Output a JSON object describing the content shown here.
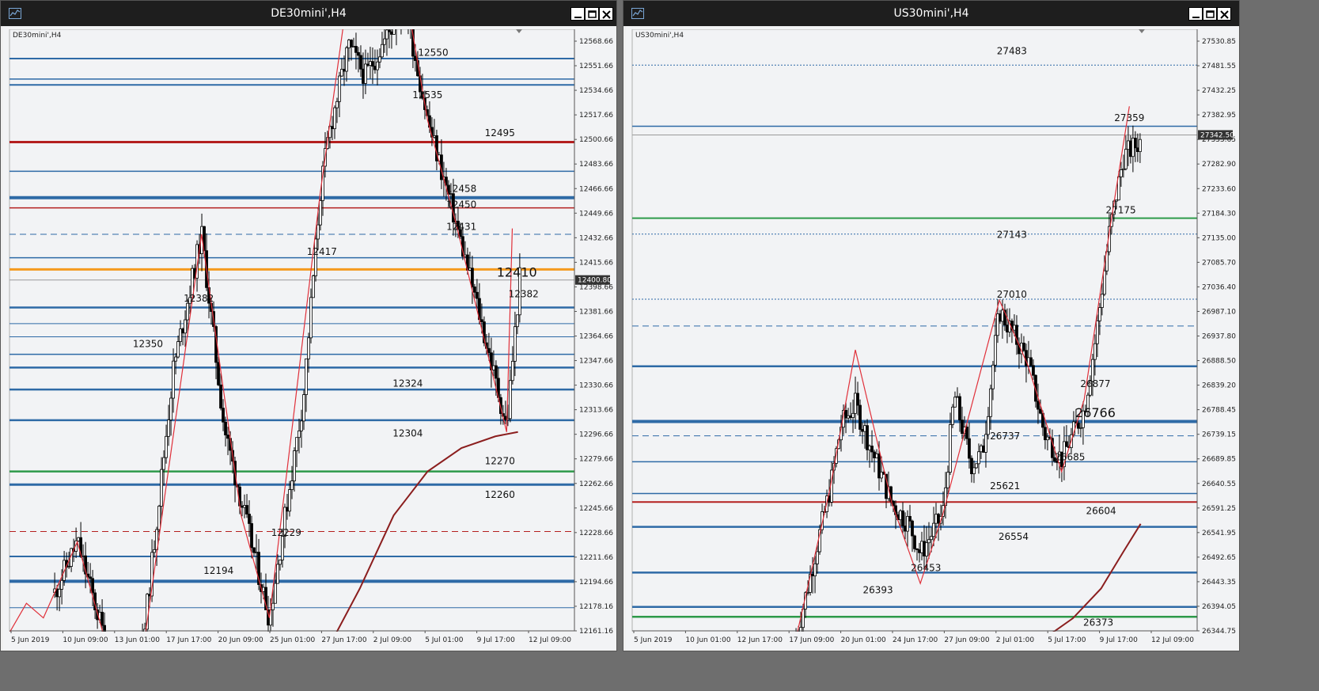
{
  "colors": {
    "bg": "#f2f3f5",
    "blue": "#2e6aa6",
    "blue_light": "#4a80ba",
    "red": "#b41f1f",
    "orange": "#f59a1e",
    "green": "#2e9a4a",
    "zigzag": "#e0303a",
    "ma": "#8b1e1e",
    "candle": "#000000"
  },
  "windows": [
    {
      "title": "DE30mini',H4",
      "corner_label": "DE30mini',H4",
      "current_price": "12400.80",
      "y_min": 12161.16,
      "y_max": 12572.0,
      "price_axis": [
        "12568.66",
        "12551.66",
        "12534.66",
        "12517.66",
        "12500.66",
        "12483.66",
        "12466.66",
        "12449.66",
        "12432.66",
        "12415.66",
        "12398.66",
        "12381.66",
        "12364.66",
        "12347.66",
        "12330.66",
        "12313.66",
        "12296.66",
        "12279.66",
        "12262.66",
        "12245.66",
        "12228.66",
        "12211.66",
        "12194.66",
        "12178.16",
        "12161.16"
      ],
      "time_axis": [
        "5 Jun 2019",
        "10 Jun 09:00",
        "13 Jun 01:00",
        "17 Jun 17:00",
        "20 Jun 09:00",
        "25 Jun 01:00",
        "27 Jun 17:00",
        "2 Jul 09:00",
        "5 Jul 01:00",
        "9 Jul 17:00",
        "12 Jul 09:00"
      ],
      "hlines": [
        {
          "price": 12552,
          "color": "blue",
          "width": 2,
          "dash": false
        },
        {
          "price": 12538,
          "color": "blue",
          "width": 1.5,
          "dash": false
        },
        {
          "price": 12534,
          "color": "blue",
          "width": 2,
          "dash": false
        },
        {
          "price": 12495,
          "color": "red",
          "width": 3,
          "dash": false
        },
        {
          "price": 12475,
          "color": "blue",
          "width": 1.5,
          "dash": false
        },
        {
          "price": 12457,
          "color": "blue",
          "width": 4,
          "dash": false
        },
        {
          "price": 12450,
          "color": "red",
          "width": 1.5,
          "dash": false
        },
        {
          "price": 12432,
          "color": "blue",
          "width": 1,
          "dash": true
        },
        {
          "price": 12416,
          "color": "blue",
          "width": 1.5,
          "dash": false
        },
        {
          "price": 12408,
          "color": "orange",
          "width": 3,
          "dash": false
        },
        {
          "price": 12400.8,
          "color": "gray",
          "width": 1,
          "dash": false
        },
        {
          "price": 12382,
          "color": "blue",
          "width": 2.5,
          "dash": false
        },
        {
          "price": 12371,
          "color": "blue",
          "width": 1,
          "dash": false
        },
        {
          "price": 12362,
          "color": "blue",
          "width": 1,
          "dash": false
        },
        {
          "price": 12350,
          "color": "blue",
          "width": 1.5,
          "dash": false
        },
        {
          "price": 12341,
          "color": "blue",
          "width": 2.5,
          "dash": false
        },
        {
          "price": 12326,
          "color": "blue",
          "width": 2.5,
          "dash": false
        },
        {
          "price": 12305,
          "color": "blue",
          "width": 2.5,
          "dash": false
        },
        {
          "price": 12270,
          "color": "green",
          "width": 2.5,
          "dash": false
        },
        {
          "price": 12261,
          "color": "blue",
          "width": 3,
          "dash": false
        },
        {
          "price": 12229,
          "color": "red",
          "width": 1,
          "dash": true
        },
        {
          "price": 12212,
          "color": "blue",
          "width": 2,
          "dash": false
        },
        {
          "price": 12195,
          "color": "blue",
          "width": 4,
          "dash": false
        },
        {
          "price": 12177,
          "color": "blue",
          "width": 1,
          "dash": false
        }
      ],
      "labels": [
        {
          "text": "12550",
          "price": 12554,
          "xf": 0.75,
          "size": 12
        },
        {
          "text": "12535",
          "price": 12525,
          "xf": 0.74,
          "size": 12
        },
        {
          "text": "12495",
          "price": 12499,
          "xf": 0.868,
          "size": 12
        },
        {
          "text": "12458",
          "price": 12461,
          "xf": 0.8,
          "size": 12
        },
        {
          "text": "12450",
          "price": 12450,
          "xf": 0.8,
          "size": 12
        },
        {
          "text": "12431",
          "price": 12435,
          "xf": 0.8,
          "size": 12
        },
        {
          "text": "12417",
          "price": 12418,
          "xf": 0.553,
          "size": 12
        },
        {
          "text": "12410",
          "price": 12403,
          "xf": 0.898,
          "size": 16
        },
        {
          "text": "12382",
          "price": 12389,
          "xf": 0.91,
          "size": 12
        },
        {
          "text": "12382",
          "price": 12386,
          "xf": 0.335,
          "size": 12
        },
        {
          "text": "12350",
          "price": 12355,
          "xf": 0.245,
          "size": 12
        },
        {
          "text": "12324",
          "price": 12328,
          "xf": 0.705,
          "size": 12
        },
        {
          "text": "12304",
          "price": 12294,
          "xf": 0.705,
          "size": 12
        },
        {
          "text": "12270",
          "price": 12275,
          "xf": 0.868,
          "size": 12
        },
        {
          "text": "12260",
          "price": 12252,
          "xf": 0.868,
          "size": 12
        },
        {
          "text": "12229",
          "price": 12226,
          "xf": 0.49,
          "size": 12
        },
        {
          "text": "12194",
          "price": 12200,
          "xf": 0.37,
          "size": 12
        }
      ],
      "zigzag": [
        [
          0.0,
          12160
        ],
        [
          0.03,
          12180
        ],
        [
          0.06,
          12170
        ],
        [
          0.12,
          12222
        ],
        [
          0.18,
          12140
        ],
        [
          0.23,
          12130
        ],
        [
          0.34,
          12432
        ],
        [
          0.41,
          12240
        ],
        [
          0.46,
          12170
        ],
        [
          0.55,
          12460
        ],
        [
          0.6,
          12600
        ],
        [
          0.7,
          12600
        ],
        [
          0.74,
          12510
        ],
        [
          0.79,
          12440
        ],
        [
          0.88,
          12297
        ],
        [
          0.89,
          12436
        ]
      ],
      "ma": [
        [
          0.565,
          12150
        ],
        [
          0.62,
          12190
        ],
        [
          0.68,
          12240
        ],
        [
          0.74,
          12270
        ],
        [
          0.8,
          12286
        ],
        [
          0.86,
          12294
        ],
        [
          0.9,
          12297
        ]
      ],
      "candles_seed": 11,
      "candle_path": [
        [
          0.0,
          12160
        ],
        [
          0.03,
          12180
        ],
        [
          0.06,
          12170
        ],
        [
          0.12,
          12222
        ],
        [
          0.18,
          12140
        ],
        [
          0.23,
          12130
        ],
        [
          0.29,
          12340
        ],
        [
          0.34,
          12432
        ],
        [
          0.38,
          12300
        ],
        [
          0.41,
          12250
        ],
        [
          0.46,
          12170
        ],
        [
          0.52,
          12320
        ],
        [
          0.55,
          12460
        ],
        [
          0.565,
          12500
        ],
        [
          0.6,
          12560
        ],
        [
          0.63,
          12540
        ],
        [
          0.7,
          12590
        ],
        [
          0.74,
          12510
        ],
        [
          0.79,
          12440
        ],
        [
          0.83,
          12380
        ],
        [
          0.88,
          12300
        ],
        [
          0.905,
          12410
        ]
      ],
      "candle_start": 0.08
    },
    {
      "title": "US30mini',H4",
      "corner_label": "US30mini',H4",
      "current_price": "27342.50",
      "y_min": 26344.75,
      "y_max": 27555.0,
      "price_axis": [
        "27530.85",
        "27481.55",
        "27432.25",
        "27382.95",
        "27333.65",
        "27282.90",
        "27233.60",
        "27184.30",
        "27135.00",
        "27085.70",
        "27036.40",
        "26987.10",
        "26937.80",
        "26888.50",
        "26839.20",
        "26788.45",
        "26739.15",
        "26689.85",
        "26640.55",
        "26591.25",
        "26541.95",
        "26492.65",
        "26443.35",
        "26394.05",
        "26344.75"
      ],
      "time_axis": [
        "5 Jun 2019",
        "10 Jun 01:00",
        "12 Jun 17:00",
        "17 Jun 09:00",
        "20 Jun 01:00",
        "24 Jun 17:00",
        "27 Jun 09:00",
        "2 Jul 01:00",
        "5 Jul 17:00",
        "9 Jul 17:00",
        "12 Jul 09:00"
      ],
      "hlines": [
        {
          "price": 27483,
          "color": "blue",
          "width": 1,
          "dash": "dot"
        },
        {
          "price": 27360,
          "color": "blue",
          "width": 1.5,
          "dash": false
        },
        {
          "price": 27342.5,
          "color": "gray",
          "width": 1,
          "dash": false
        },
        {
          "price": 27175,
          "color": "green",
          "width": 2,
          "dash": false
        },
        {
          "price": 27143,
          "color": "blue",
          "width": 1,
          "dash": "dot"
        },
        {
          "price": 27012,
          "color": "blue",
          "width": 1,
          "dash": "dot"
        },
        {
          "price": 26958,
          "color": "blue",
          "width": 1,
          "dash": true
        },
        {
          "price": 26877,
          "color": "blue",
          "width": 2.5,
          "dash": false
        },
        {
          "price": 26766,
          "color": "blue",
          "width": 4,
          "dash": false
        },
        {
          "price": 26737,
          "color": "blue",
          "width": 1,
          "dash": true
        },
        {
          "price": 26685,
          "color": "blue",
          "width": 1.5,
          "dash": false
        },
        {
          "price": 26621,
          "color": "blue",
          "width": 1.5,
          "dash": false
        },
        {
          "price": 26604,
          "color": "red",
          "width": 2,
          "dash": false
        },
        {
          "price": 26554,
          "color": "blue",
          "width": 2.5,
          "dash": false
        },
        {
          "price": 26462,
          "color": "blue",
          "width": 2.5,
          "dash": false
        },
        {
          "price": 26393,
          "color": "blue",
          "width": 2.5,
          "dash": false
        },
        {
          "price": 26373,
          "color": "green",
          "width": 2.5,
          "dash": false
        }
      ],
      "labels": [
        {
          "text": "27483",
          "price": 27505,
          "xf": 0.672,
          "size": 12
        },
        {
          "text": "27359",
          "price": 27370,
          "xf": 0.88,
          "size": 12
        },
        {
          "text": "27175",
          "price": 27185,
          "xf": 0.865,
          "size": 12
        },
        {
          "text": "27143",
          "price": 27135,
          "xf": 0.672,
          "size": 12
        },
        {
          "text": "27010",
          "price": 27015,
          "xf": 0.672,
          "size": 12
        },
        {
          "text": "26877",
          "price": 26835,
          "xf": 0.82,
          "size": 12
        },
        {
          "text": "26766",
          "price": 26775,
          "xf": 0.82,
          "size": 16
        },
        {
          "text": "26737",
          "price": 26730,
          "xf": 0.66,
          "size": 12
        },
        {
          "text": "26685",
          "price": 26688,
          "xf": 0.775,
          "size": 12
        },
        {
          "text": "25621",
          "price": 26630,
          "xf": 0.66,
          "size": 12
        },
        {
          "text": "26604",
          "price": 26580,
          "xf": 0.83,
          "size": 12
        },
        {
          "text": "26554",
          "price": 26528,
          "xf": 0.675,
          "size": 12
        },
        {
          "text": "26453",
          "price": 26465,
          "xf": 0.52,
          "size": 12
        },
        {
          "text": "26393",
          "price": 26420,
          "xf": 0.435,
          "size": 12
        },
        {
          "text": "26373",
          "price": 26355,
          "xf": 0.825,
          "size": 12
        }
      ],
      "zigzag": [
        [
          0.29,
          26330
        ],
        [
          0.35,
          26630
        ],
        [
          0.395,
          26910
        ],
        [
          0.46,
          26600
        ],
        [
          0.51,
          26440
        ],
        [
          0.55,
          26580
        ],
        [
          0.65,
          27010
        ],
        [
          0.7,
          26880
        ],
        [
          0.76,
          26665
        ],
        [
          0.8,
          26810
        ],
        [
          0.845,
          27150
        ],
        [
          0.88,
          27400
        ]
      ],
      "ma": [
        [
          0.73,
          26330
        ],
        [
          0.78,
          26370
        ],
        [
          0.83,
          26430
        ],
        [
          0.87,
          26505
        ],
        [
          0.9,
          26560
        ]
      ],
      "candles_seed": 7,
      "candle_path": [
        [
          0.29,
          26330
        ],
        [
          0.32,
          26480
        ],
        [
          0.35,
          26630
        ],
        [
          0.37,
          26760
        ],
        [
          0.395,
          26800
        ],
        [
          0.42,
          26720
        ],
        [
          0.46,
          26600
        ],
        [
          0.49,
          26560
        ],
        [
          0.51,
          26500
        ],
        [
          0.55,
          26580
        ],
        [
          0.57,
          26820
        ],
        [
          0.6,
          26680
        ],
        [
          0.62,
          26700
        ],
        [
          0.65,
          26990
        ],
        [
          0.7,
          26890
        ],
        [
          0.73,
          26740
        ],
        [
          0.76,
          26690
        ],
        [
          0.8,
          26790
        ],
        [
          0.82,
          26930
        ],
        [
          0.845,
          27150
        ],
        [
          0.87,
          27300
        ],
        [
          0.9,
          27330
        ]
      ],
      "candle_start": 0.29
    }
  ]
}
